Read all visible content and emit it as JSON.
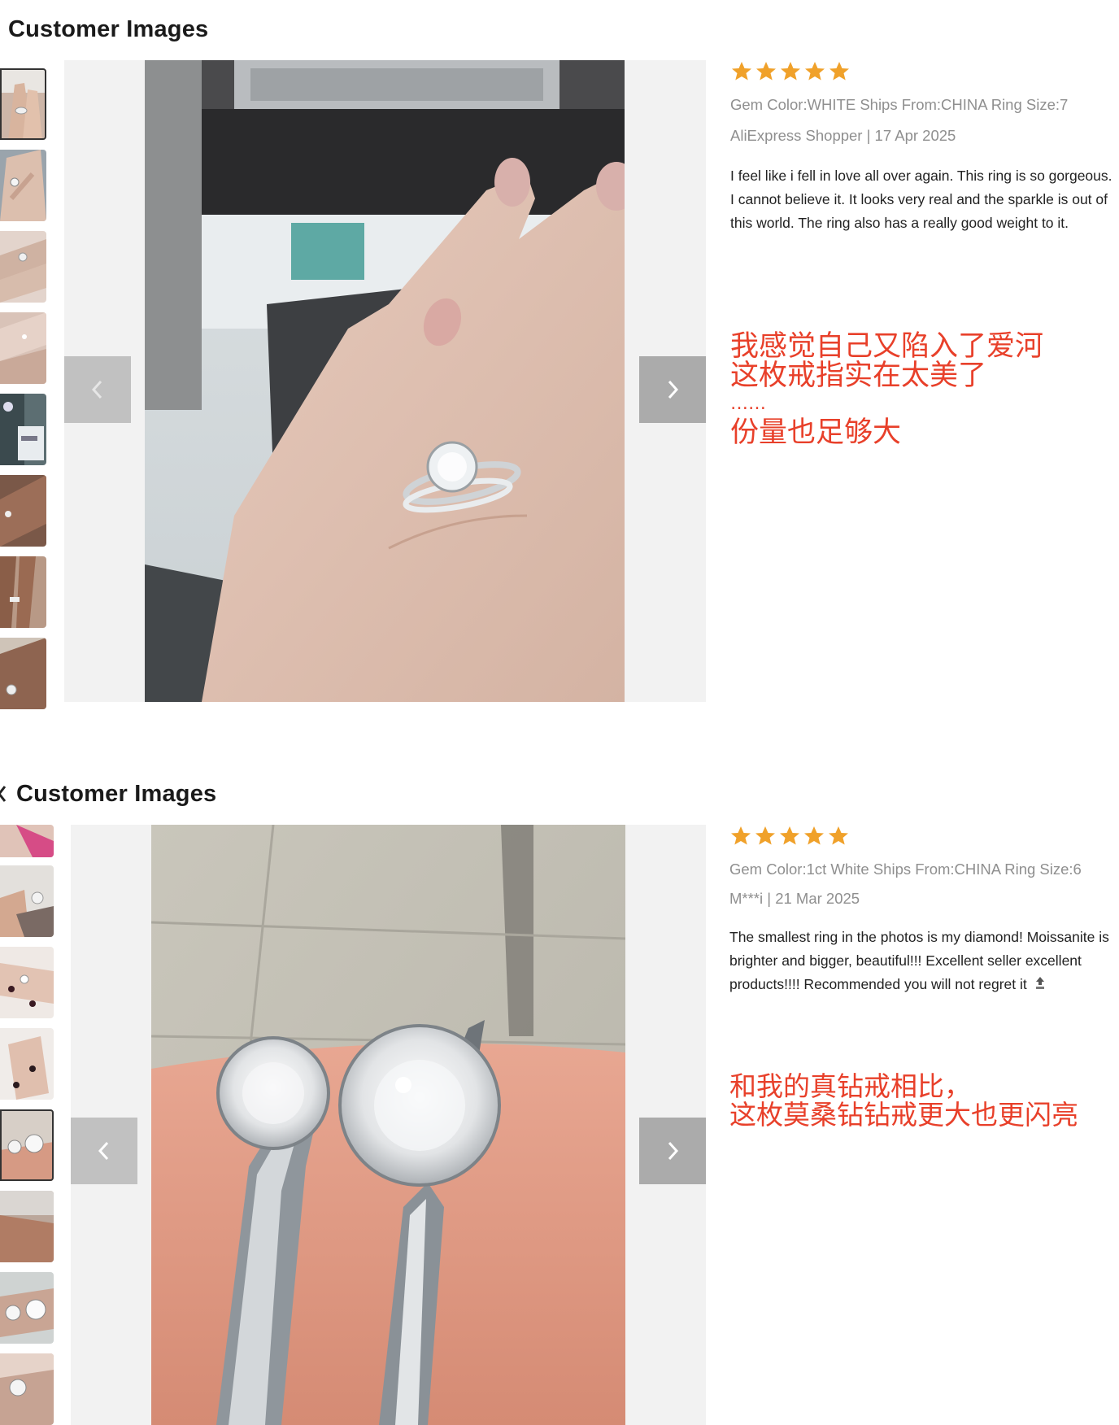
{
  "reviews": [
    {
      "section_title": "Customer Images",
      "rating": 5,
      "star_color": "#f0a12a",
      "attributes": "Gem Color:WHITE Ships From:CHINA Ring Size:7",
      "author_date": "AliExpress Shopper | 17 Apr 2025",
      "text": "I feel like i fell in love all over again. This ring is so gorgeous. I cannot believe it. It looks very real and the sparkle is out of this world. The ring also has a really good weight to it.",
      "annotation": [
        "我感觉自己又陷入了爱河",
        "这枚戒指实在太美了",
        "……",
        "份量也足够大"
      ],
      "prev_icon": "chevron-left-icon",
      "next_icon": "chevron-right-icon"
    },
    {
      "section_title": "Customer Images",
      "back_icon": "chevron-left-icon",
      "rating": 5,
      "star_color": "#f0a12a",
      "attributes": "Gem Color:1ct White Ships From:CHINA Ring Size:6",
      "author_date": "M***i | 21 Mar 2025",
      "text": "The smallest ring in the photos is my diamond! Moissanite is brighter and bigger, beautiful!!! Excellent seller excellent products!!!! Recommended you will not regret it",
      "text_icon": "top-arrow-icon",
      "annotation": [
        "和我的真钻戒相比，",
        "这枚莫桑钻钻戒更大也更闪亮"
      ],
      "prev_icon": "chevron-left-icon",
      "next_icon": "chevron-right-icon"
    }
  ]
}
